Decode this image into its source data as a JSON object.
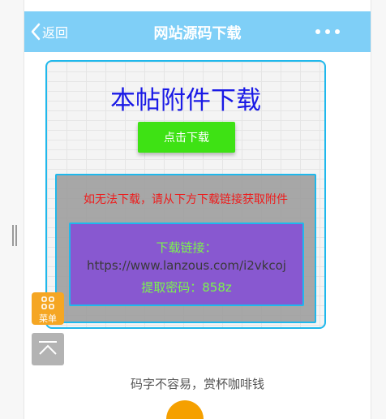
{
  "header": {
    "back_label": "返回",
    "title": "网站源码下载",
    "bg_color": "#7fcff7"
  },
  "card": {
    "title": "本帖附件下载",
    "download_button": "点击下载",
    "warning": "如无法下载，请从下方下载链接获取附件",
    "link_label": "下载链接：",
    "link_url": "https://www.lanzous.com/i2vkcoj",
    "code_line": "提取密码：858z",
    "colors": {
      "title": "#1a1ae6",
      "button": "#3ee214",
      "warning": "#ee1c1c",
      "panel": "#8858d0",
      "border": "#1fb8ec"
    }
  },
  "floating": {
    "menu_label": "菜单",
    "menu_icon": "grid-icon",
    "top_icon": "back-to-top-icon"
  },
  "footer": {
    "tip": "码字不容易，赏杯咖啡钱",
    "reward_color": "#f5a000"
  }
}
